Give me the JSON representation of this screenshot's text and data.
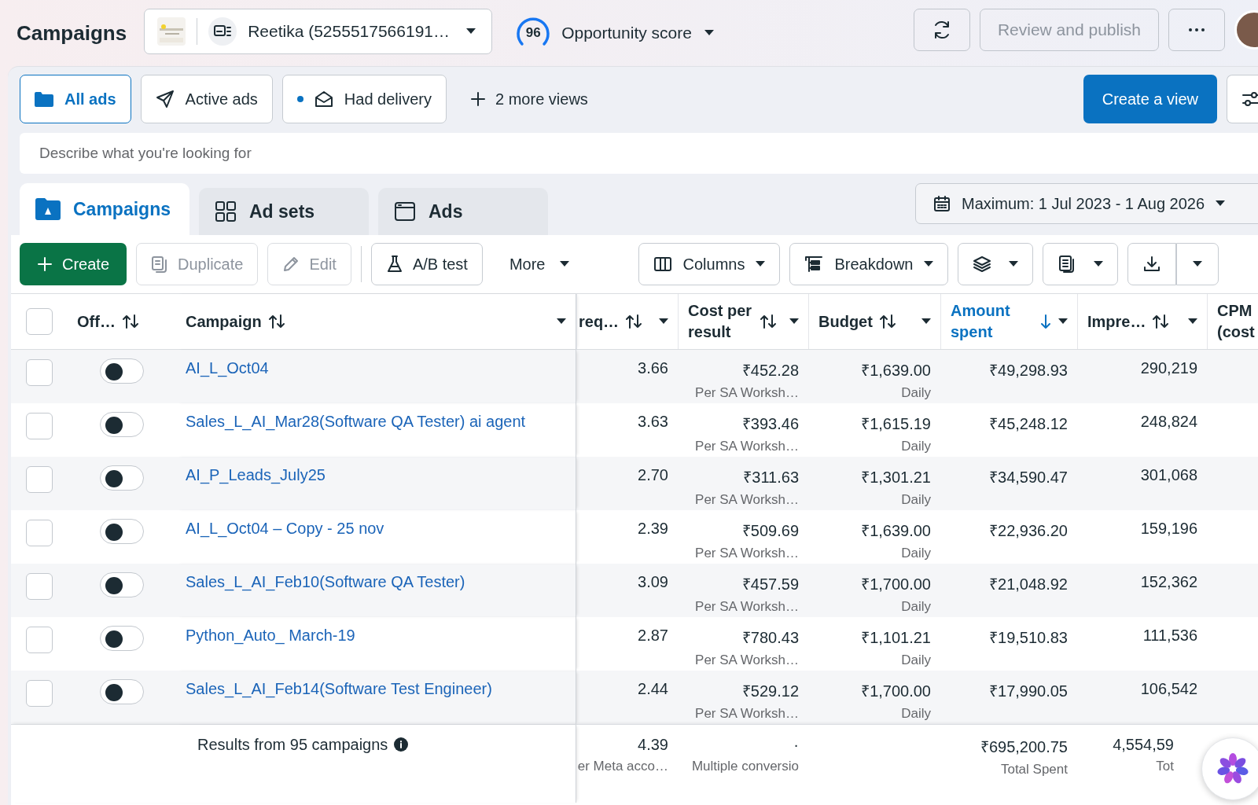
{
  "header": {
    "title": "Campaigns",
    "account": "Reetika (5255517566191…",
    "score": "96",
    "score_label": "Opportunity score",
    "publish": {
      "label": "Review and publish",
      "disabled": true
    }
  },
  "views": {
    "items": [
      {
        "label": "All ads",
        "selected": true
      },
      {
        "label": "Active ads",
        "selected": false
      },
      {
        "label": "Had delivery",
        "selected": false
      }
    ],
    "more": "2 more views",
    "create": "Create a view"
  },
  "search": {
    "placeholder": "Describe what you're looking for"
  },
  "level_tabs": [
    {
      "label": "Campaigns",
      "selected": true
    },
    {
      "label": "Ad sets",
      "selected": false
    },
    {
      "label": "Ads",
      "selected": false
    }
  ],
  "date_range": "Maximum: 1 Jul 2023 - 1 Aug 2026",
  "toolbar": {
    "create": "Create",
    "actions": [
      {
        "label": "Duplicate",
        "disabled": true
      },
      {
        "label": "Edit",
        "disabled": true
      },
      {
        "label": "A/B test",
        "disabled": false
      }
    ],
    "more": "More",
    "columns": "Columns",
    "breakdown": "Breakdown"
  },
  "table": {
    "select_all_checked": false,
    "columns": [
      {
        "label": "Off…",
        "sorted": false
      },
      {
        "label": "Campaign",
        "sorted": false
      },
      {
        "label": "req…",
        "sorted": false
      },
      {
        "label": "Cost per result",
        "sorted": false
      },
      {
        "label": "Budget",
        "sorted": false
      },
      {
        "label": "Amount spent",
        "sorted": true
      },
      {
        "label": "Impre…",
        "sorted": false
      },
      {
        "label": "CPM (cost",
        "sorted": false
      }
    ],
    "rows": [
      {
        "checked": false,
        "on": false,
        "campaign": "AI_L_Oct04",
        "frequency": "3.66",
        "cost_per_result": "₹452.28",
        "result_type": "Per SA Worksh…",
        "budget": "₹1,639.00",
        "budget_type": "Daily",
        "amount_spent": "₹49,298.93",
        "impressions": "290,219"
      },
      {
        "checked": false,
        "on": false,
        "campaign": "Sales_L_AI_Mar28(Software QA Tester) ai agent",
        "frequency": "3.63",
        "cost_per_result": "₹393.46",
        "result_type": "Per SA Worksh…",
        "budget": "₹1,615.19",
        "budget_type": "Daily",
        "amount_spent": "₹45,248.12",
        "impressions": "248,824"
      },
      {
        "checked": false,
        "on": false,
        "campaign": "AI_P_Leads_July25",
        "frequency": "2.70",
        "cost_per_result": "₹311.63",
        "result_type": "Per SA Worksh…",
        "budget": "₹1,301.21",
        "budget_type": "Daily",
        "amount_spent": "₹34,590.47",
        "impressions": "301,068"
      },
      {
        "checked": false,
        "on": false,
        "campaign": "AI_L_Oct04 – Copy - 25 nov",
        "frequency": "2.39",
        "cost_per_result": "₹509.69",
        "result_type": "Per SA Worksh…",
        "budget": "₹1,639.00",
        "budget_type": "Daily",
        "amount_spent": "₹22,936.20",
        "impressions": "159,196"
      },
      {
        "checked": false,
        "on": false,
        "campaign": "Sales_L_AI_Feb10(Software QA Tester)",
        "frequency": "3.09",
        "cost_per_result": "₹457.59",
        "result_type": "Per SA Worksh…",
        "budget": "₹1,700.00",
        "budget_type": "Daily",
        "amount_spent": "₹21,048.92",
        "impressions": "152,362"
      },
      {
        "checked": false,
        "on": false,
        "campaign": "Python_Auto_ March-19",
        "frequency": "2.87",
        "cost_per_result": "₹780.43",
        "result_type": "Per SA Worksh…",
        "budget": "₹1,101.21",
        "budget_type": "Daily",
        "amount_spent": "₹19,510.83",
        "impressions": "111,536"
      },
      {
        "checked": false,
        "on": false,
        "campaign": "Sales_L_AI_Feb14(Software Test Engineer)",
        "frequency": "2.44",
        "cost_per_result": "₹529.12",
        "result_type": "Per SA Worksh…",
        "budget": "₹1,700.00",
        "budget_type": "Daily",
        "amount_spent": "₹17,990.05",
        "impressions": "106,542"
      }
    ],
    "summary": {
      "label": "Results from 95 campaigns",
      "frequency": "4.39",
      "frequency_note": "er Meta acco…",
      "cost_per_result": "·",
      "cost_note": "Multiple conversio",
      "amount_spent": "₹695,200.75",
      "amount_note": "Total Spent",
      "impressions": "4,554,59",
      "impressions_note": "Tot"
    }
  }
}
